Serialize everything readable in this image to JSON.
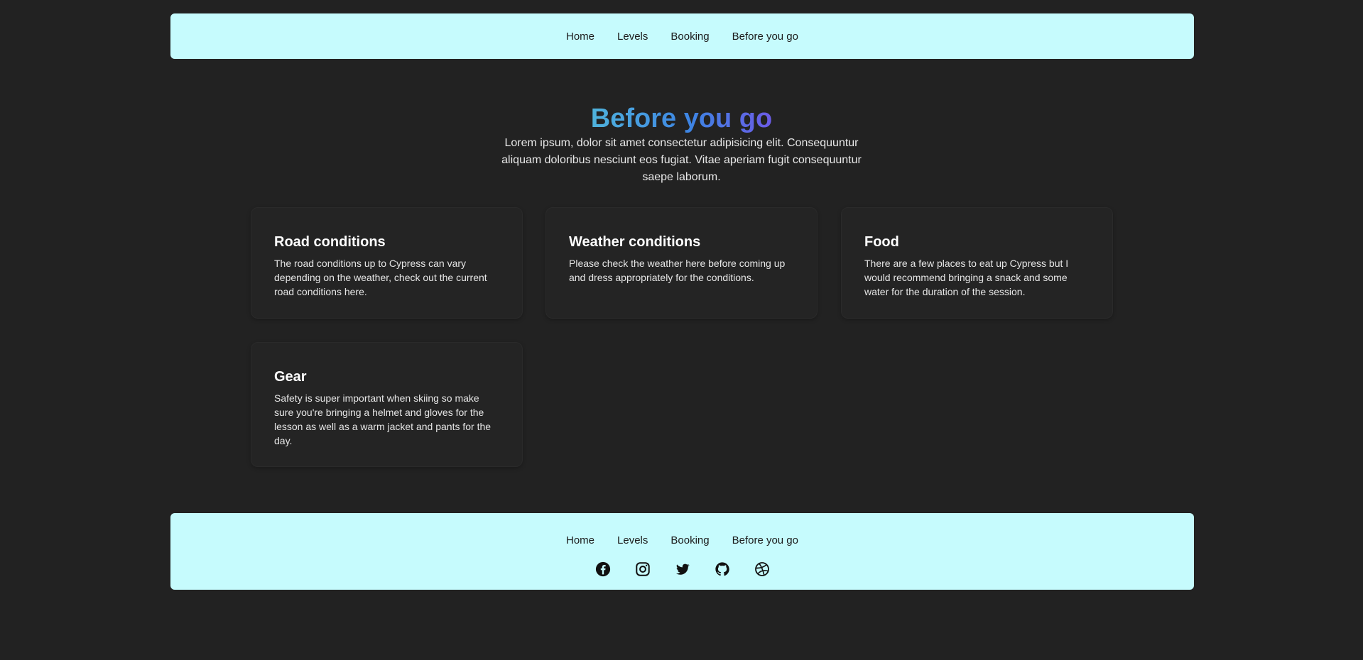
{
  "nav": {
    "items": [
      {
        "label": "Home"
      },
      {
        "label": "Levels"
      },
      {
        "label": "Booking"
      },
      {
        "label": "Before you go"
      }
    ]
  },
  "hero": {
    "title": "Before you go",
    "description": "Lorem ipsum, dolor sit amet consectetur adipisicing elit. Consequuntur aliquam doloribus nesciunt eos fugiat. Vitae aperiam fugit consequuntur saepe laborum."
  },
  "cards": [
    {
      "title": "Road conditions",
      "text": "The road conditions up to Cypress can vary depending on the weather, check out the current road conditions here."
    },
    {
      "title": "Weather conditions",
      "text": "Please check the weather here before coming up and dress appropriately for the conditions."
    },
    {
      "title": "Food",
      "text": "There are a few places to eat up Cypress but I would recommend bringing a snack and some water for the duration of the session."
    },
    {
      "title": "Gear",
      "text": "Safety is super important when skiing so make sure you're bringing a helmet and gloves for the lesson as well as a warm jacket and pants for the day."
    }
  ],
  "footer": {
    "items": [
      {
        "label": "Home"
      },
      {
        "label": "Levels"
      },
      {
        "label": "Booking"
      },
      {
        "label": "Before you go"
      }
    ],
    "socials": [
      "facebook-icon",
      "instagram-icon",
      "twitter-icon",
      "github-icon",
      "dribbble-icon"
    ]
  },
  "colors": {
    "background": "#222222",
    "nav_background": "#c6fbfd",
    "title_gradient": [
      "#4fb3dc",
      "#3d84e3",
      "#6c5be6"
    ]
  }
}
